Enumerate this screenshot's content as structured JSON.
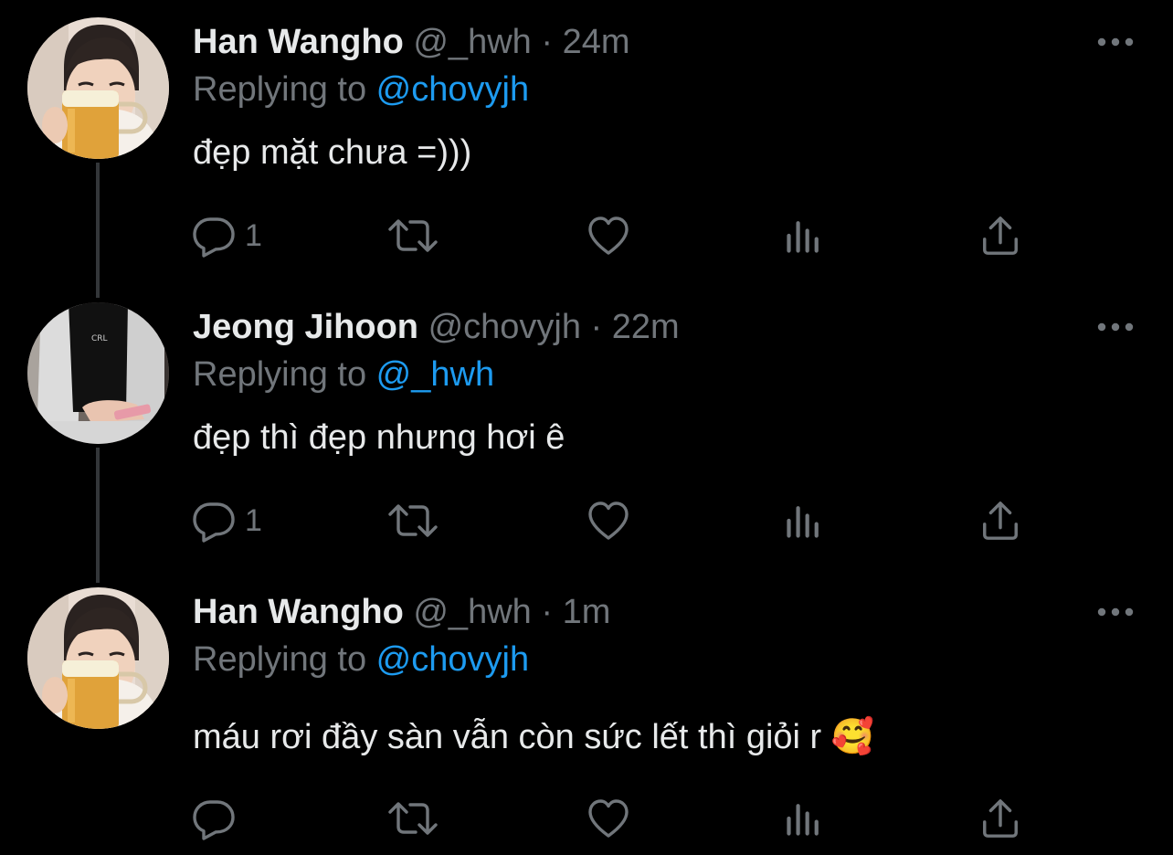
{
  "colors": {
    "background": "#000000",
    "primary_text": "#e7e9ea",
    "secondary_text": "#71767b",
    "mention": "#1d9bf0",
    "thread_line": "#333639"
  },
  "tweets": [
    {
      "name": "Han Wangho",
      "handle": "@_hwh",
      "separator": "·",
      "time": "24m",
      "replying_prefix": "Replying to ",
      "replying_to": "@chovyjh",
      "text": "đẹp mặt chưa =)))",
      "reply_count": "1",
      "icons": [
        "reply-icon",
        "retweet-icon",
        "like-icon",
        "analytics-icon",
        "share-icon",
        "more-icon"
      ]
    },
    {
      "name": "Jeong Jihoon",
      "handle": "@chovyjh",
      "separator": "·",
      "time": "22m",
      "replying_prefix": "Replying to ",
      "replying_to": "@_hwh",
      "text": "đẹp thì đẹp nhưng hơi ê",
      "reply_count": "1",
      "icons": [
        "reply-icon",
        "retweet-icon",
        "like-icon",
        "analytics-icon",
        "share-icon",
        "more-icon"
      ]
    },
    {
      "name": "Han Wangho",
      "handle": "@_hwh",
      "separator": "·",
      "time": "1m",
      "replying_prefix": "Replying to ",
      "replying_to": "@chovyjh",
      "text": "máu rơi đầy sàn vẫn còn sức lết thì giỏi r 🥰",
      "reply_count": "",
      "icons": [
        "reply-icon",
        "retweet-icon",
        "like-icon",
        "analytics-icon",
        "share-icon",
        "more-icon"
      ]
    }
  ]
}
